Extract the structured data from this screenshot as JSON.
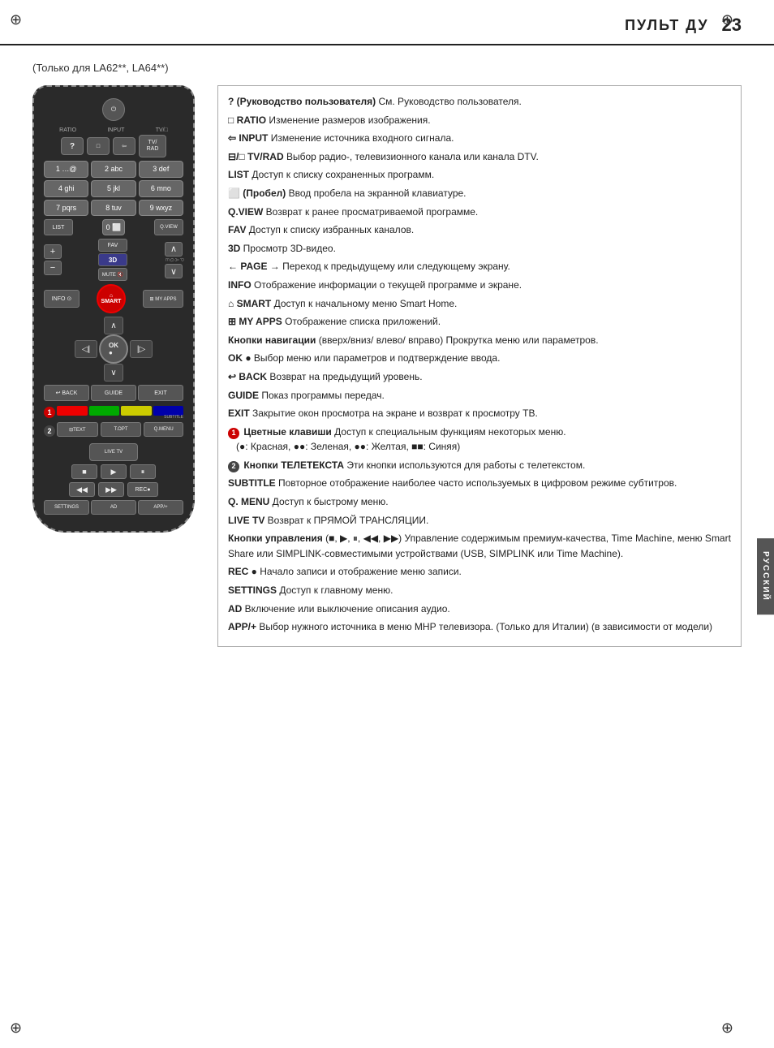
{
  "page": {
    "title": "ПУЛЬТ ДУ",
    "number": "23",
    "subtitle": "(Только для LA62**, LA64**)"
  },
  "remote": {
    "power": "⏻",
    "labels": [
      "RATIO",
      "INPUT",
      "TV/□"
    ],
    "buttons": {
      "ratio": "□",
      "input": "⇦",
      "tv_rad": "TV/\nRAD",
      "q": "?",
      "num1": "1 …@",
      "num2": "2 abc",
      "num3": "3 def",
      "num4": "4 ghi",
      "num5": "5 jkl",
      "num6": "6 mno",
      "num7": "7 pqrs",
      "num8": "8 tuv",
      "num9": "9 wxyz",
      "list": "LIST",
      "num0": "0 ⬜",
      "qview": "Q.VIEW",
      "vol_up": "+",
      "vol_down": "−",
      "fav": "FAV",
      "three_d": "3D",
      "mute": "MUTE 🔇",
      "prog_up": "∧",
      "prog_down": "∨",
      "info": "INFO ⊙",
      "smart": "SMART",
      "myapps": "⊞ MY APPS",
      "nav_up": "∧",
      "nav_left": "◁",
      "ok": "OK\n●",
      "nav_right": "▷",
      "nav_down": "∨",
      "back": "BACK",
      "guide": "GUIDE",
      "exit": "EXIT",
      "color_red": "",
      "color_green": "",
      "color_yellow": "",
      "color_blue": "",
      "text": "⊟TEXT",
      "t_opt": "T.OPT",
      "q_menu": "Q.MENU",
      "live_tv": "LIVE TV",
      "play": "▶",
      "pause": "⏸",
      "stop": "■",
      "rew": "◀◀",
      "ff": "▶▶",
      "rec": "REC●",
      "settings": "SETTINGS",
      "ad": "AD",
      "app": "APP/+"
    }
  },
  "descriptions": [
    {
      "bold": "? (Руководство пользователя)",
      "text": " См. Руководство пользователя."
    },
    {
      "bold": "□ RATIO",
      "text": " Изменение размеров изображения."
    },
    {
      "bold": "⇦ INPUT",
      "text": " Изменение источника входного сигнала."
    },
    {
      "bold": "⊟/□ TV/RAD",
      "text": " Выбор радио-, телевизионного канала или канала DTV."
    },
    {
      "bold": "LIST",
      "text": " Доступ к списку сохраненных программ."
    },
    {
      "bold": "⬜ (Пробел)",
      "text": " Ввод пробела на экранной клавиатуре."
    },
    {
      "bold": "Q.VIEW",
      "text": " Возврат к ранее просматриваемой программе."
    },
    {
      "bold": "FAV",
      "text": " Доступ к списку избранных каналов."
    },
    {
      "bold": "3D",
      "text": " Просмотр 3D-видео."
    },
    {
      "bold": "← PAGE →",
      "text": " Переход к предыдущему или следующему экрану."
    },
    {
      "bold": "INFO",
      "text": " Отображение информации о текущей программе и экране."
    },
    {
      "bold": "⌂ SMART",
      "text": " Доступ к начальному меню Smart Home."
    },
    {
      "bold": "⊞ MY APPS",
      "text": " Отображение списка приложений."
    },
    {
      "bold": "Кнопки навигации",
      "text": " (вверх/вниз/ влево/ вправо) Прокрутка меню или параметров."
    },
    {
      "bold": "OK ●",
      "text": " Выбор меню или параметров и подтверждение ввода."
    },
    {
      "bold": "↩ BACK",
      "text": " Возврат на предыдущий уровень."
    },
    {
      "bold": "GUIDE",
      "text": " Показ программы передач."
    },
    {
      "bold": "EXIT",
      "text": " Закрытие окон просмотра на экране и возврат к просмотру ТВ."
    },
    {
      "badge": "1",
      "bold": " Цветные клавиши",
      "text": " Доступ к специальным функциям некоторых меню. (●: Красная, ●●: Зеленая, ●●: Желтая, ■■: Синяя)"
    },
    {
      "badge": "2",
      "bold": " Кнопки ТЕЛЕТЕКСТА",
      "text": " Эти кнопки используются для работы с телетекстом."
    },
    {
      "bold": "SUBTITLE",
      "text": " Повторное отображение наиболее часто используемых в цифровом режиме субтитров."
    },
    {
      "bold": "Q. MENU",
      "text": " Доступ к быстрому меню."
    },
    {
      "bold": "LIVE TV",
      "text": " Возврат к ПРЯМОЙ ТРАНСЛЯЦИИ."
    },
    {
      "bold": "Кнопки управления",
      "text": " (■, ▶, ⏸, ◀◀, ▶▶) Управление содержимым премиум-качества, Time Machine, меню Smart Share или SIMPLINK-совместимыми устройствами (USB, SIMPLINK или Time Machine)."
    },
    {
      "bold": "REC ●",
      "text": " Начало записи и отображение меню записи."
    },
    {
      "bold": "SETTINGS",
      "text": " Доступ к главному меню."
    },
    {
      "bold": "AD",
      "text": " Включение или выключение описания аудио."
    },
    {
      "bold": "APP/+",
      "text": " Выбор нужного источника в меню МНР телевизора. (Только для Италии) (в зависимости от модели)"
    }
  ],
  "russian_label": "РУССКИЙ"
}
